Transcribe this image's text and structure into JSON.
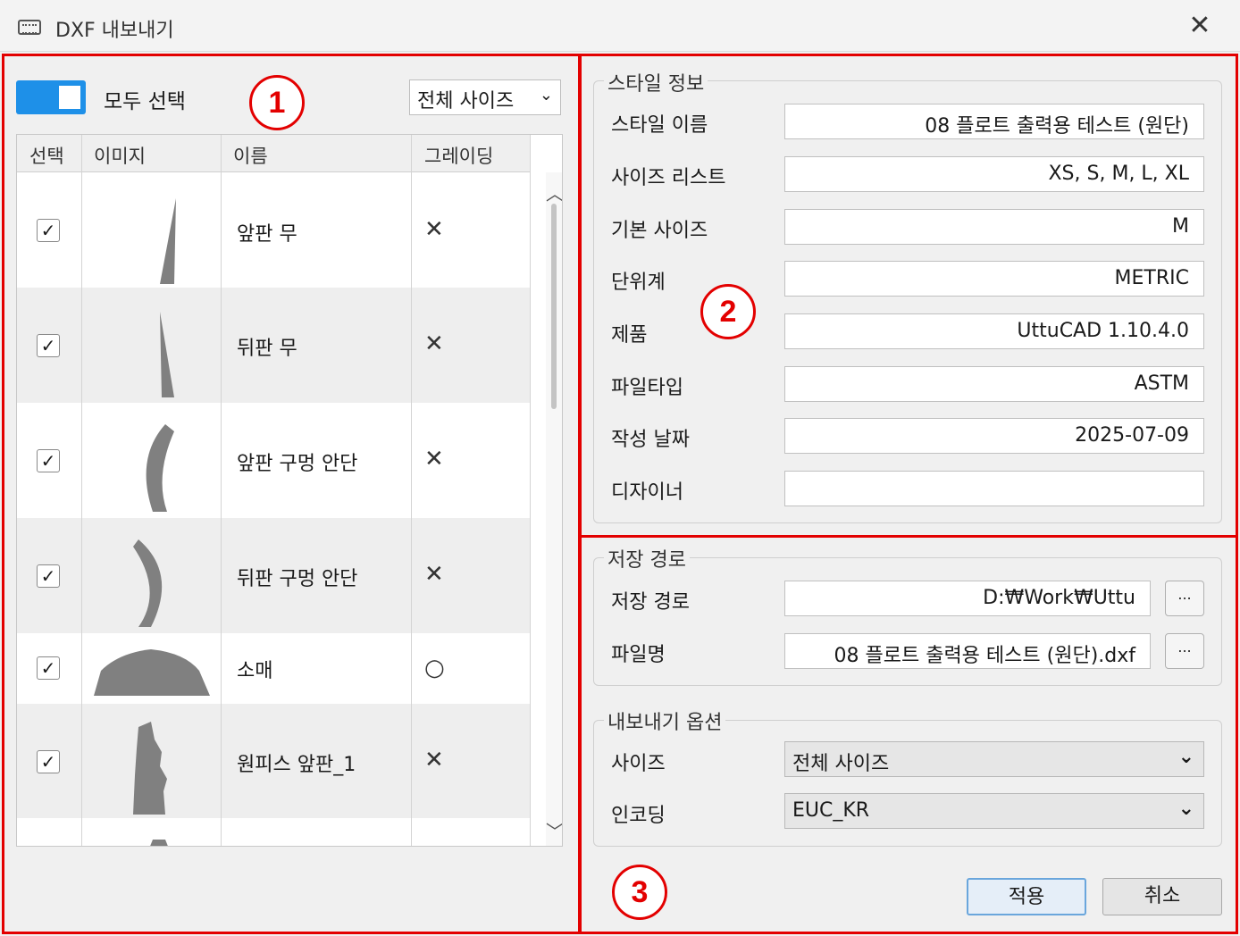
{
  "window": {
    "title": "DXF 내보내기",
    "close_glyph": "✕"
  },
  "badges": [
    "1",
    "2",
    "3"
  ],
  "left": {
    "select_all_label": "모두 선택",
    "size_dropdown": "전체 사이즈",
    "columns": [
      "선택",
      "이미지",
      "이름",
      "그레이딩"
    ],
    "rows": [
      {
        "checked": true,
        "name": "앞판 무",
        "grading": "✕",
        "icon": "front-piece-shape"
      },
      {
        "checked": true,
        "name": "뒤판 무",
        "grading": "✕",
        "icon": "back-piece-shape"
      },
      {
        "checked": true,
        "name": "앞판 구멍 안단",
        "grading": "✕",
        "icon": "front-armhole-facing-shape"
      },
      {
        "checked": true,
        "name": "뒤판 구멍 안단",
        "grading": "✕",
        "icon": "back-armhole-facing-shape"
      },
      {
        "checked": true,
        "name": "소매",
        "grading": "○",
        "icon": "sleeve-shape"
      },
      {
        "checked": true,
        "name": "원피스 앞판_1",
        "grading": "✕",
        "icon": "dress-front-shape"
      }
    ],
    "check_glyph": "✓"
  },
  "style_info": {
    "title": "스타일 정보",
    "fields": [
      {
        "label": "스타일 이름",
        "value": "08 플로트 출력용 테스트 (원단)"
      },
      {
        "label": "사이즈 리스트",
        "value": "XS, S, M, L, XL"
      },
      {
        "label": "기본 사이즈",
        "value": "M"
      },
      {
        "label": "단위계",
        "value": "METRIC"
      },
      {
        "label": "제품",
        "value": "UttuCAD 1.10.4.0"
      },
      {
        "label": "파일타입",
        "value": "ASTM"
      },
      {
        "label": "작성 날짜",
        "value": "2025-07-09"
      },
      {
        "label": "디자이너",
        "value": ""
      }
    ]
  },
  "save_path": {
    "title": "저장 경로",
    "path_label": "저장 경로",
    "path_value": "D:₩Work₩Uttu",
    "file_label": "파일명",
    "file_value": "08 플로트 출력용 테스트 (원단).dxf",
    "browse_label": "..."
  },
  "export_options": {
    "title": "내보내기 옵션",
    "size_label": "사이즈",
    "size_value": "전체 사이즈",
    "encoding_label": "인코딩",
    "encoding_value": "EUC_KR"
  },
  "buttons": {
    "apply": "적용",
    "cancel": "취소"
  },
  "colors": {
    "highlight": "#e30000",
    "toggle": "#1e90e8",
    "shape": "#808080"
  }
}
